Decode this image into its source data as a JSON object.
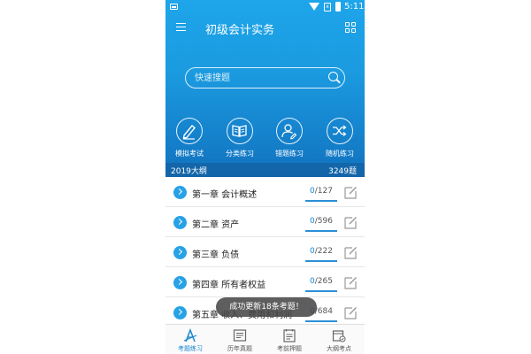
{
  "status_bar": {
    "time": "5:11"
  },
  "app_bar": {
    "title": "初级会计实务"
  },
  "search": {
    "placeholder": "快速搜题"
  },
  "modules": [
    {
      "label": "模拟考试",
      "icon": "pencil-icon"
    },
    {
      "label": "分类练习",
      "icon": "book-icon"
    },
    {
      "label": "错题练习",
      "icon": "user-edit-icon"
    },
    {
      "label": "随机练习",
      "icon": "shuffle-icon"
    }
  ],
  "syllabus": {
    "year_label": "2019大纲",
    "total": "3249题"
  },
  "chapters": [
    {
      "title": "第一章 会计概述",
      "done": "0",
      "total": "/127"
    },
    {
      "title": "第二章 资产",
      "done": "0",
      "total": "/596"
    },
    {
      "title": "第三章 负债",
      "done": "0",
      "total": "/222"
    },
    {
      "title": "第四章 所有者权益",
      "done": "0",
      "total": "/265"
    },
    {
      "title": "第五章 收入、费用和利润",
      "done": "0",
      "total": "/684"
    }
  ],
  "toast": "成功更新18条考题！",
  "tabs": [
    {
      "label": "考题练习",
      "active": true
    },
    {
      "label": "历年真题",
      "active": false
    },
    {
      "label": "考前押题",
      "active": false
    },
    {
      "label": "大纲考点",
      "active": false
    }
  ],
  "colors": {
    "primary": "#1b9be0",
    "accent": "#1b86d0"
  }
}
